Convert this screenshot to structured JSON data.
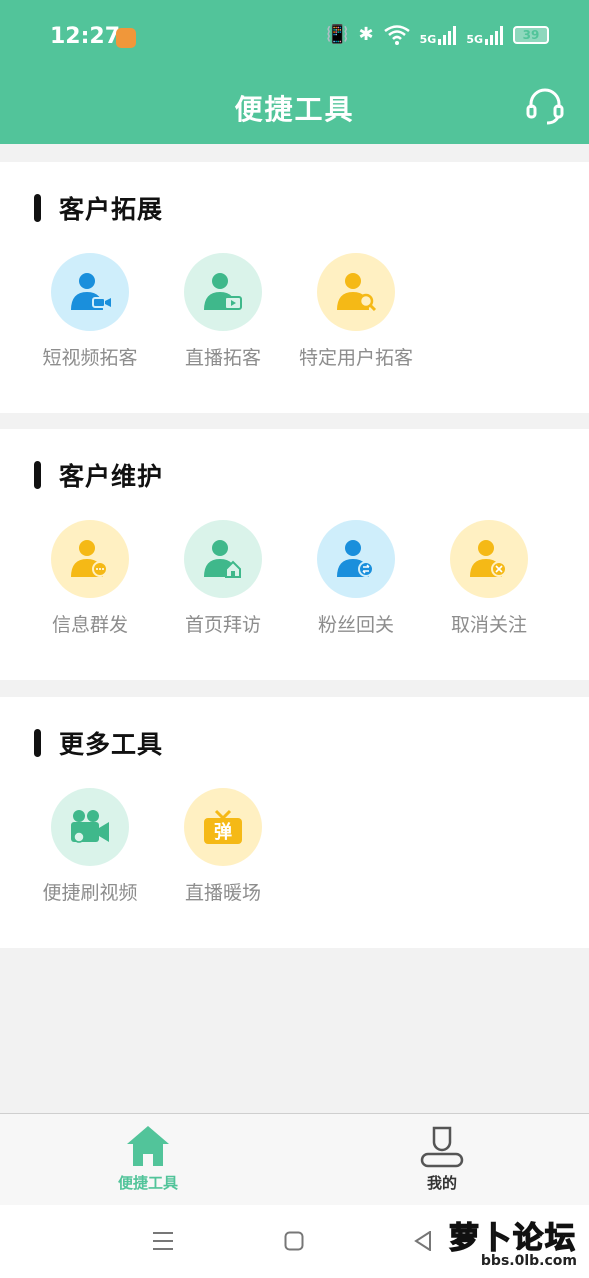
{
  "status": {
    "time": "12:27",
    "network_5g_1": "5G",
    "network_5g_2": "5G",
    "battery": "39"
  },
  "header": {
    "title": "便捷工具"
  },
  "sections": [
    {
      "title": "客户拓展",
      "tools": [
        {
          "label": "短视频拓客"
        },
        {
          "label": "直播拓客"
        },
        {
          "label": "特定用户拓客"
        }
      ]
    },
    {
      "title": "客户维护",
      "tools": [
        {
          "label": "信息群发"
        },
        {
          "label": "首页拜访"
        },
        {
          "label": "粉丝回关"
        },
        {
          "label": "取消关注"
        }
      ]
    },
    {
      "title": "更多工具",
      "tools": [
        {
          "label": "便捷刷视频"
        },
        {
          "label": "直播暖场",
          "badge": "弹"
        }
      ]
    }
  ],
  "bottom_nav": {
    "items": [
      {
        "label": "便捷工具"
      },
      {
        "label": "我的"
      }
    ]
  },
  "watermark": {
    "main": "萝卜论坛",
    "url": "bbs.0lb.com"
  },
  "colors": {
    "brand": "#52c49a",
    "blue_person": "#1a8fdc",
    "green_person": "#3fb88b",
    "yellow_person": "#f5b916"
  }
}
